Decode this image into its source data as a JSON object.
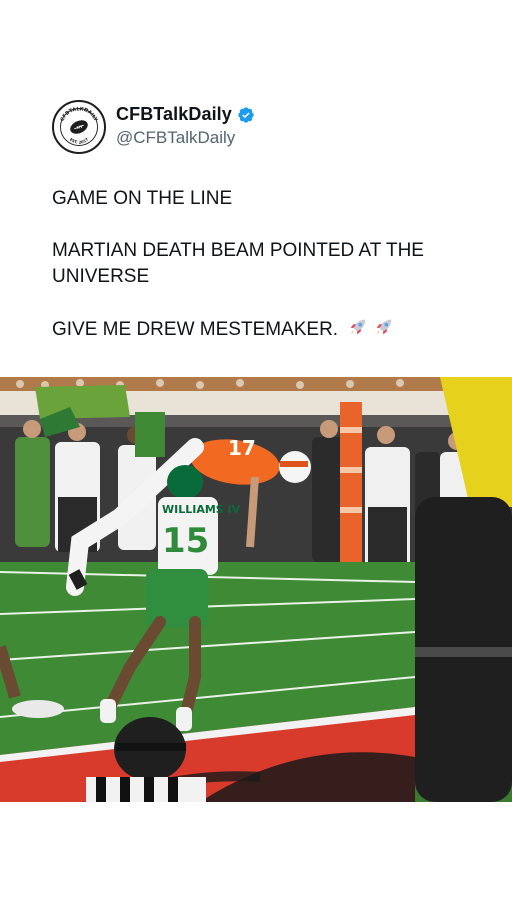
{
  "post": {
    "display_name": "CFBTalkDaily",
    "handle": "@CFBTalkDaily",
    "verified": true,
    "verified_color": "#1d9bf0",
    "avatar": {
      "top_text": "CFBTALKDAILY",
      "bottom_text": "EST. 2017",
      "icon": "football-logo-icon"
    },
    "text": {
      "line1": "GAME ON THE LINE",
      "line2": "MARTIAN DEATH BEAM POINTED AT THE UNIVERSE",
      "line3": "GIVE ME DREW MESTEMAKER.",
      "emoji": [
        "rocket-icon",
        "rocket-icon"
      ]
    }
  },
  "media": {
    "type": "photo",
    "description_icon": "football-catch-photo",
    "jersey_number": "15",
    "jersey_name": "WILLIAMS IV",
    "receiver_number": "17",
    "colors": {
      "field_green": "#3f8a34",
      "endzone_red": "#d83b2c",
      "orange_jersey": "#f26a21",
      "oregon_green": "#0a6b3a"
    }
  }
}
